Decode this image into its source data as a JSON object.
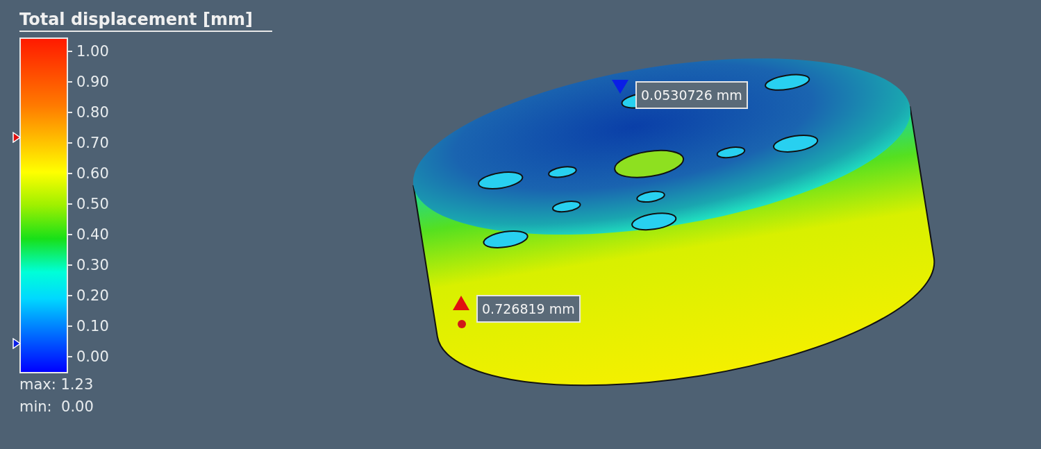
{
  "legend": {
    "title": "Total displacement [mm]",
    "ticks": [
      "1.00",
      "0.90",
      "0.80",
      "0.70",
      "0.60",
      "0.50",
      "0.40",
      "0.30",
      "0.20",
      "0.10",
      "0.00"
    ],
    "max": "max: 1.23",
    "min": "min:  0.00"
  },
  "probes": [
    {
      "kind": "min",
      "value": "0.0530726 mm",
      "level": 0.0530726
    },
    {
      "kind": "max",
      "value": "0.726819 mm",
      "level": 0.726819
    }
  ]
}
